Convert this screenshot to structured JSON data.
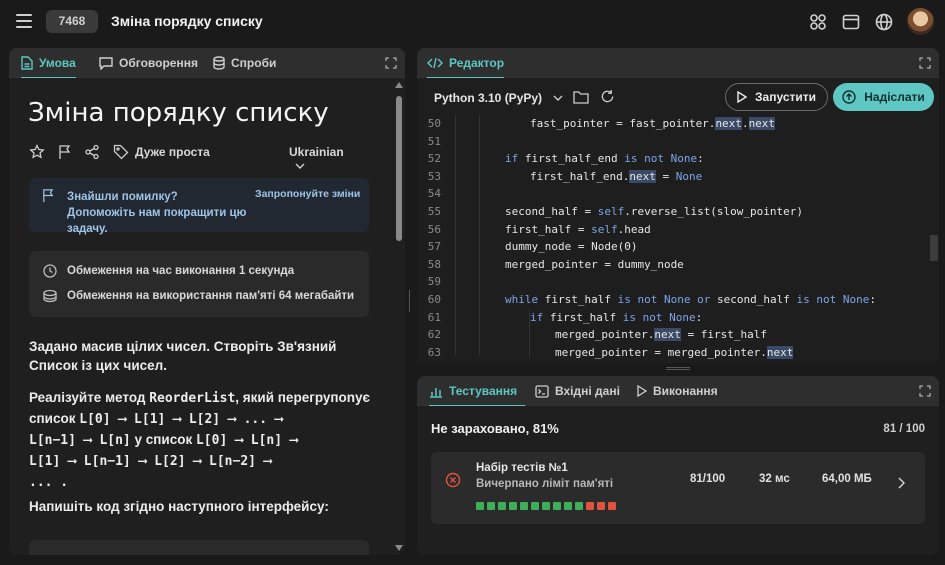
{
  "header": {
    "problem_id": "7468",
    "title": "Зміна порядку списку",
    "icons": [
      "grid-icon",
      "window-icon",
      "globe-icon"
    ]
  },
  "left_panel": {
    "tabs": [
      {
        "label": "Умова",
        "icon": "document-icon",
        "active": true
      },
      {
        "label": "Обговорення",
        "icon": "chat-icon",
        "active": false
      },
      {
        "label": "Спроби",
        "icon": "database-icon",
        "active": false
      }
    ],
    "problem_title": "Зміна порядку списку",
    "difficulty": "Дуже проста",
    "language": "Ukrainian",
    "notice": {
      "text": "Знайшли помилку? Допоможіть нам покращити цю задачу.",
      "link": "Запропонуйте зміни"
    },
    "limits": {
      "time": "Обмеження на час виконання 1 секунда",
      "memory": "Обмеження на використання пам'яті 64 мегабайти"
    },
    "description": {
      "p1": "Задано масив цілих чисел. Створіть Зв'язний Список із цих чисел.",
      "p2_a": "Реалізуйте метод ",
      "p2_code": "ReorderList",
      "p2_b": ", який перегрупоnує список",
      "seq1": "L[0] ⟶ L[1] ⟶ L[2] ⟶ ... ⟶",
      "seq2a": "L[n−1] ⟶ L[n]",
      "seq2b": " у список ",
      "seq2c": "L[0] ⟶ L[n] ⟶",
      "seq3": "L[1] ⟶ L[n−1] ⟶ L[2] ⟶ L[n−2] ⟶",
      "seq4": "... .",
      "p3": "Напишіть код згідно наступного інтерфейсу:"
    }
  },
  "editor": {
    "tab": "Редактор",
    "language": "Python 3.10 (PyPy)",
    "run_label": "Запустити",
    "submit_label": "Надіслати",
    "lines": [
      {
        "n": "50",
        "indent": 2,
        "html": "fast_pointer = fast_pointer.<span class=\"hl\">next</span>.<span class=\"hl\">next</span>"
      },
      {
        "n": "51",
        "indent": 0,
        "html": ""
      },
      {
        "n": "52",
        "indent": 1,
        "html": "<span class=\"kw\">if</span> first_half_end <span class=\"kw\">is not</span> <span class=\"kw\">None</span>:"
      },
      {
        "n": "53",
        "indent": 2,
        "html": "first_half_end.<span class=\"hl\">next</span> = <span class=\"kw\">None</span>"
      },
      {
        "n": "54",
        "indent": 0,
        "html": ""
      },
      {
        "n": "55",
        "indent": 1,
        "html": "second_half = <span class=\"kw\">self</span>.reverse_list(slow_pointer)"
      },
      {
        "n": "56",
        "indent": 1,
        "html": "first_half = <span class=\"kw\">self</span>.head"
      },
      {
        "n": "57",
        "indent": 1,
        "html": "dummy_node = Node(0)"
      },
      {
        "n": "58",
        "indent": 1,
        "html": "merged_pointer = dummy_node"
      },
      {
        "n": "59",
        "indent": 0,
        "html": ""
      },
      {
        "n": "60",
        "indent": 1,
        "html": "<span class=\"kw\">while</span> first_half <span class=\"kw\">is not</span> <span class=\"kw\">None</span> <span class=\"kw\">or</span> second_half <span class=\"kw\">is not</span> <span class=\"kw\">None</span>:"
      },
      {
        "n": "61",
        "indent": 2,
        "html": "<span class=\"kw\">if</span> first_half <span class=\"kw\">is not</span> <span class=\"kw\">None</span>:"
      },
      {
        "n": "62",
        "indent": 3,
        "html": "merged_pointer.<span class=\"hl\">next</span> = first_half"
      },
      {
        "n": "63",
        "indent": 3,
        "html": "merged_pointer = merged_pointer.<span class=\"hl\">next</span>"
      }
    ]
  },
  "testing": {
    "tabs": [
      {
        "label": "Тестування",
        "icon": "chart-icon",
        "active": true
      },
      {
        "label": "Вхідні дані",
        "icon": "terminal-icon",
        "active": false
      },
      {
        "label": "Виконання",
        "icon": "play-icon",
        "active": false
      }
    ],
    "verdict": "Не зараховано, 81%",
    "counts": "81 / 100",
    "test_set": {
      "title": "Набір тестів №1",
      "subtitle": "Вичерпано ліміт пам'яті",
      "score": "81/100",
      "time": "32 мс",
      "memory": "64,00 МБ",
      "dots": [
        "pass",
        "pass",
        "pass",
        "pass",
        "pass",
        "pass",
        "pass",
        "pass",
        "pass",
        "pass",
        "fail",
        "fail",
        "fail"
      ]
    },
    "colors": {
      "pass": "#3fae5a",
      "fail": "#e0533f"
    }
  },
  "colors": {
    "accent": "#5ec7c4",
    "background": "#1a1a1a"
  }
}
